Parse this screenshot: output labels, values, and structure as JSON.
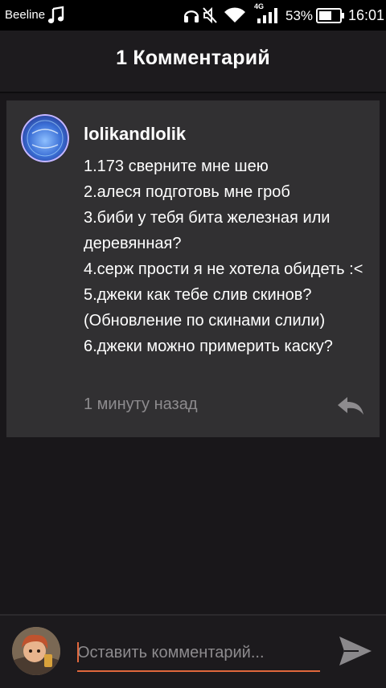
{
  "status_bar": {
    "carrier": "Beeline",
    "network_type": "4G",
    "battery_percent": "53%",
    "time": "16:01"
  },
  "header": {
    "title": "1 Комментарий"
  },
  "comment": {
    "username": "lolikandlolik",
    "lines": [
      "1.173 сверните мне шею",
      "2.алеся подготовь мне гроб",
      "3.биби у тебя бита железная или деревянная?",
      "4.серж прости я не хотела обидеть :<",
      "5.джеки как тебе слив скинов? (Обновление по скинами слили)",
      "6.джеки можно примерить каску?"
    ],
    "timestamp": "1 минуту назад"
  },
  "input_bar": {
    "placeholder": "Оставить комментарий..."
  },
  "colors": {
    "background": "#19171a",
    "card": "#313032",
    "accent": "#e0673c",
    "muted_text": "#8d8b8e"
  },
  "icons": [
    "music-note-icon",
    "headset-icon",
    "mute-icon",
    "wifi-icon",
    "signal-icon",
    "battery-icon",
    "reply-icon",
    "send-icon"
  ]
}
